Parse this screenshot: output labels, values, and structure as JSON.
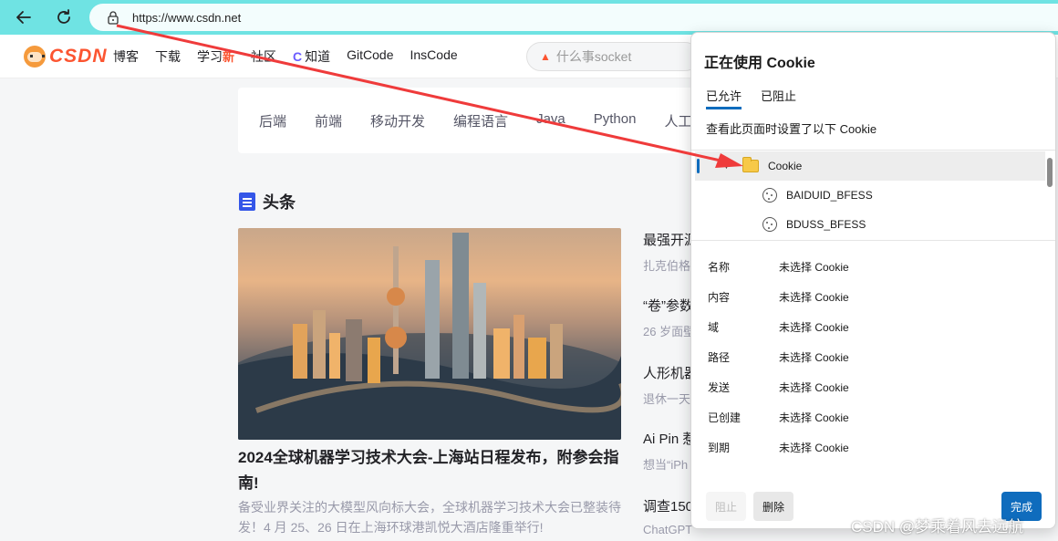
{
  "browser": {
    "url": "https://www.csdn.net"
  },
  "csdn": {
    "logo_text": "CSDN",
    "nav": [
      {
        "label": "博客"
      },
      {
        "label": "下载"
      },
      {
        "label": "学习",
        "badge": "新"
      },
      {
        "label": "社区"
      },
      {
        "label": "知道",
        "icon": "C"
      },
      {
        "label": "GitCode"
      },
      {
        "label": "InsCode"
      }
    ],
    "search_placeholder": "什么事socket",
    "categories": [
      "后端",
      "前端",
      "移动开发",
      "编程语言",
      "Java",
      "Python",
      "人工"
    ],
    "section_title": "头条",
    "hero": {
      "title": "2024全球机器学习技术大会-上海站日程发布，附参会指南!",
      "desc": "备受业界关注的大模型风向标大会，全球机器学习技术大会已整装待发！4 月 25、26 日在上海环球港凯悦大酒店隆重举行!"
    },
    "news": [
      {
        "title": "最强开源",
        "sub": "扎克伯格"
      },
      {
        "title": "“卷”参数",
        "sub": "26 岁面壁"
      },
      {
        "title": "人形机器",
        "sub": "退休一天"
      },
      {
        "title": "Ai Pin 惹",
        "sub": "想当“iPh"
      },
      {
        "title": "调查150",
        "sub": "ChatGPT"
      }
    ]
  },
  "cookie_panel": {
    "title": "正在使用 Cookie",
    "tab_allowed": "已允许",
    "tab_blocked": "已阻止",
    "description": "查看此页面时设置了以下 Cookie",
    "tree": {
      "folder": "Cookie",
      "items": [
        "BAIDUID_BFESS",
        "BDUSS_BFESS"
      ]
    },
    "details": [
      {
        "key": "名称",
        "value": "未选择 Cookie"
      },
      {
        "key": "内容",
        "value": "未选择 Cookie"
      },
      {
        "key": "域",
        "value": "未选择 Cookie"
      },
      {
        "key": "路径",
        "value": "未选择 Cookie"
      },
      {
        "key": "发送",
        "value": "未选择 Cookie"
      },
      {
        "key": "已创建",
        "value": "未选择 Cookie"
      },
      {
        "key": "到期",
        "value": "未选择 Cookie"
      }
    ],
    "btn_block": "阻止",
    "btn_delete": "删除",
    "btn_done": "完成"
  },
  "watermark": "CSDN @梦乘着风去远航",
  "colors": {
    "toolbar": "#6fe3e3",
    "accent_blue": "#0f6cbd",
    "csdn_red": "#fc5531",
    "annotation_arrow": "#ef3b3b"
  }
}
